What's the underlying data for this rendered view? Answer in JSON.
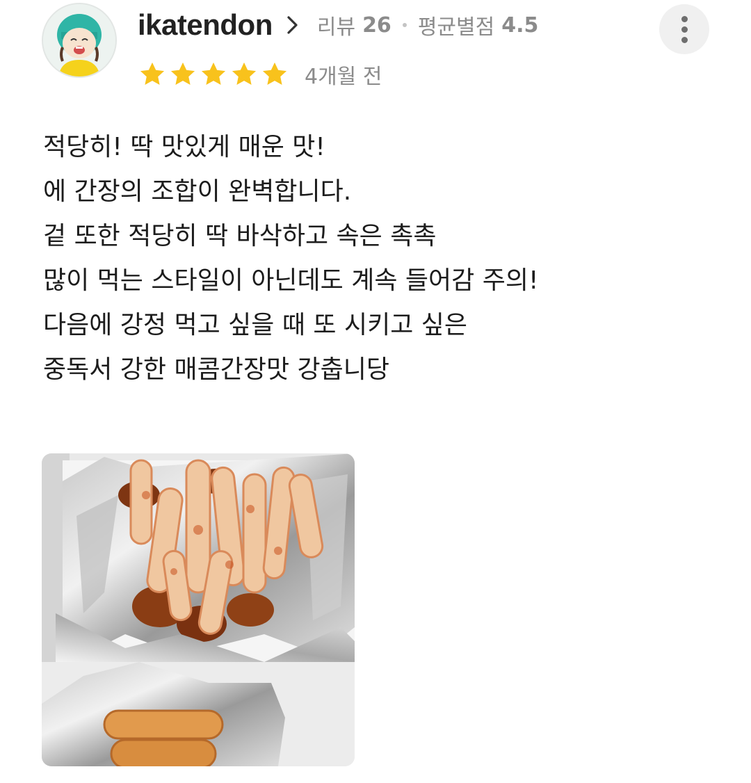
{
  "review": {
    "username": "ikatendon",
    "review_count_label": "리뷰",
    "review_count": "26",
    "avg_rating_label": "평균별점",
    "avg_rating": "4.5",
    "stars": 5,
    "star_color": "#f8c21c",
    "time_ago": "4개월 전",
    "body_lines": [
      "적당히! 딱 맛있게 매운 맛!",
      "에 간장의 조합이 완벽합니다.",
      "겉 또한 적당히 딱 바삭하고 속은 촉촉",
      "많이 먹는 스타일이 아닌데도 계속 들어감 주의!",
      "다음에 강정 먹고 싶을 때 또 시키고 싶은",
      "중독서 강한 매콤간장맛 강춥니당"
    ]
  },
  "icons": {
    "avatar": "user-avatar-illustration",
    "profile_arrow": "chevron-right-icon",
    "more": "more-vertical-icon",
    "star": "star-icon"
  }
}
